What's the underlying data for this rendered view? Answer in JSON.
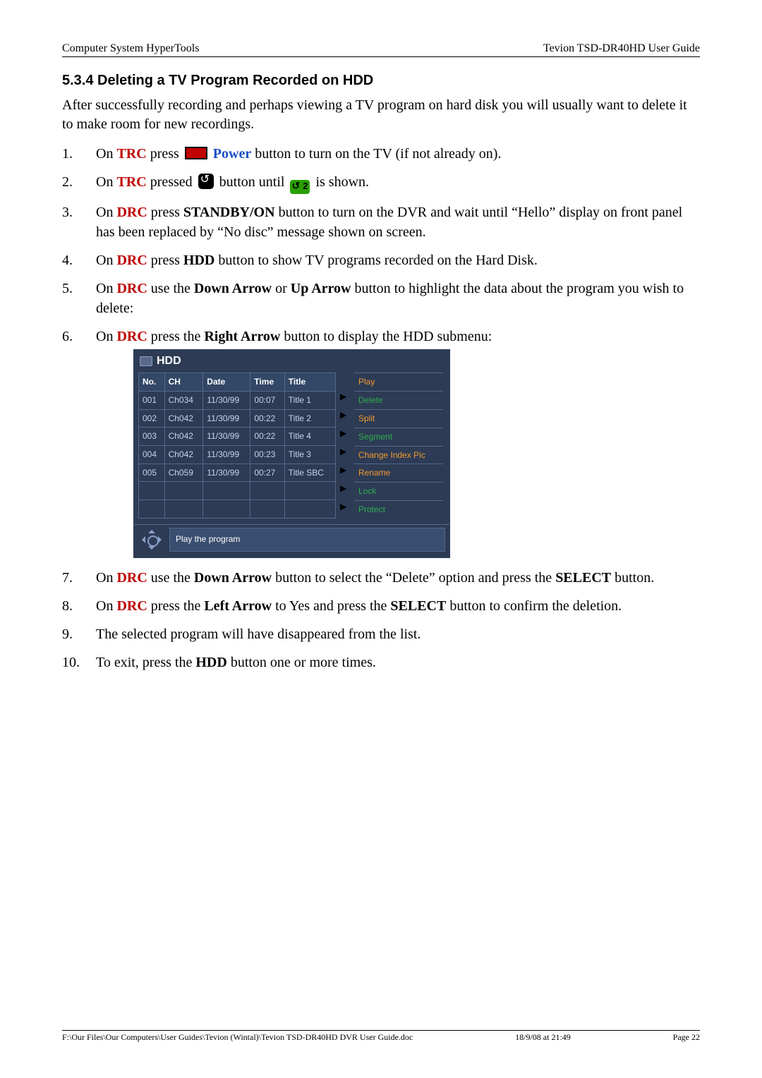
{
  "header": {
    "left": "Computer System HyperTools",
    "right": "Tevion TSD-DR40HD User Guide"
  },
  "section_title": "5.3.4  Deleting a TV Program Recorded on HDD",
  "intro": "After successfully recording and perhaps viewing a TV program on hard disk you will usually want to delete it to make room for new recordings.",
  "labels": {
    "trc": "TRC",
    "drc": "DRC",
    "power": "Power",
    "on": "On ",
    "press": " press ",
    "pressed": " pressed ",
    "use_the": " use the ",
    "press_the": " press the ",
    "right_arrow": "Right Arrow",
    "down_arrow": "Down Arrow",
    "up_arrow": "Up Arrow",
    "left_arrow": "Left Arrow",
    "select": "SELECT",
    "hdd": "HDD",
    "standby_on": "STANDBY/ON",
    "or": " or ",
    "green_two": "2"
  },
  "steps": {
    "n1": "1.",
    "t1_tail": " button to turn on the TV (if not already on).",
    "n2": "2.",
    "t2_mid": " button until ",
    "t2_tail": " is shown.",
    "n3": "3.",
    "t3_tail": " button to turn on the DVR and wait until “Hello” display on front panel has been replaced by “No disc” message shown on screen.",
    "n4": "4.",
    "t4_tail": " button to show TV programs recorded on the Hard Disk.",
    "n5": "5.",
    "t5_tail": " button to highlight the data about the program you wish to delete:",
    "n6": "6.",
    "t6_tail": " button to display the HDD submenu:",
    "n7": "7.",
    "t7_mid": " button to select the “Delete” option and press the ",
    "t7_tail": " button.",
    "n8": "8.",
    "t8_mid": " to Yes and press the ",
    "t8_tail": " button to confirm the deletion.",
    "n9": "9.",
    "t9": "The selected program will have disappeared from the list.",
    "n10": "10.",
    "t10_pre": "To exit, press the ",
    "t10_tail": " button one or more times."
  },
  "hdd_menu": {
    "title": "HDD",
    "columns": {
      "no": "No.",
      "ch": "CH",
      "date": "Date",
      "time": "Time",
      "title": "Title"
    },
    "rows": [
      {
        "no": "001",
        "ch": "Ch034",
        "date": "11/30/99",
        "time": "00:07",
        "title": "Title 1"
      },
      {
        "no": "002",
        "ch": "Ch042",
        "date": "11/30/99",
        "time": "00:22",
        "title": "Title 2"
      },
      {
        "no": "003",
        "ch": "Ch042",
        "date": "11/30/99",
        "time": "00:22",
        "title": "Title 4"
      },
      {
        "no": "004",
        "ch": "Ch042",
        "date": "11/30/99",
        "time": "00:23",
        "title": "Title 3"
      },
      {
        "no": "005",
        "ch": "Ch059",
        "date": "11/30/99",
        "time": "00:27",
        "title": "Title SBC"
      }
    ],
    "submenu": [
      "Play",
      "Delete",
      "Split",
      "Segment",
      "Change Index Pic",
      "Rename",
      "Lock",
      "Protect"
    ],
    "footer_label": "Play the program"
  },
  "footer": {
    "left": "F:\\Our Files\\Our Computers\\User Guides\\Tevion (Wintal)\\Tevion TSD-DR40HD DVR User Guide.doc",
    "mid": "18/9/08 at 21:49",
    "right": "Page 22"
  }
}
